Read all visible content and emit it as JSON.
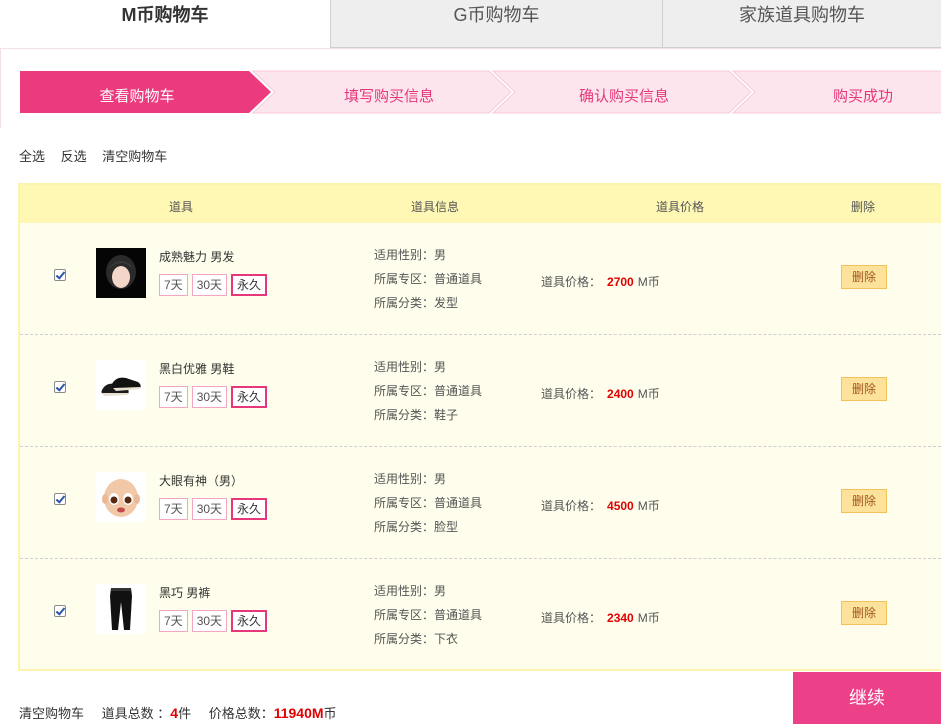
{
  "tabs": [
    {
      "label": "M币购物车"
    },
    {
      "label": "G币购物车"
    },
    {
      "label": "家族道具购物车"
    }
  ],
  "steps": [
    "查看购物车",
    "填写购买信息",
    "确认购买信息",
    "购买成功"
  ],
  "select_actions": {
    "select_all": "全选",
    "invert": "反选",
    "clear": "清空购物车"
  },
  "table": {
    "headers": {
      "item": "道具",
      "info": "道具信息",
      "price": "道具价格",
      "delete": "删除"
    },
    "rows": [
      {
        "name": "成熟魅力 男发",
        "durations": [
          "7天",
          "30天",
          "永久"
        ],
        "gender": "适用性别：男",
        "zone": "所属专区：普通道具",
        "category": "所属分类：发型",
        "price_label": "道具价格：",
        "price": "2700",
        "unit": "M币",
        "delete": "删除",
        "thumb_icon": "hair-icon"
      },
      {
        "name": "黑白优雅 男鞋",
        "durations": [
          "7天",
          "30天",
          "永久"
        ],
        "gender": "适用性别：男",
        "zone": "所属专区：普通道具",
        "category": "所属分类：鞋子",
        "price_label": "道具价格：",
        "price": "2400",
        "unit": "M币",
        "delete": "删除",
        "thumb_icon": "shoes-icon"
      },
      {
        "name": "大眼有神（男）",
        "durations": [
          "7天",
          "30天",
          "永久"
        ],
        "gender": "适用性别：男",
        "zone": "所属专区：普通道具",
        "category": "所属分类：脸型",
        "price_label": "道具价格：",
        "price": "4500",
        "unit": "M币",
        "delete": "删除",
        "thumb_icon": "face-icon"
      },
      {
        "name": "黑巧 男裤",
        "durations": [
          "7天",
          "30天",
          "永久"
        ],
        "gender": "适用性别：男",
        "zone": "所属专区：普通道具",
        "category": "所属分类：下衣",
        "price_label": "道具价格：",
        "price": "2340",
        "unit": "M币",
        "delete": "删除",
        "thumb_icon": "pants-icon"
      }
    ]
  },
  "footer": {
    "clear": "清空购物车",
    "count_label": "道具总数 ：",
    "count": "4",
    "count_unit": "件",
    "total_label": "价格总数：",
    "total": "11940M",
    "total_unit": "币",
    "continue": "继续"
  },
  "colors": {
    "accent": "#ec4088",
    "step_active": "#ec3a7f",
    "step_inactive": "#fde5ee",
    "header_bg": "#fef8b4",
    "row_bg": "#fffdec",
    "price": "#e00000"
  }
}
